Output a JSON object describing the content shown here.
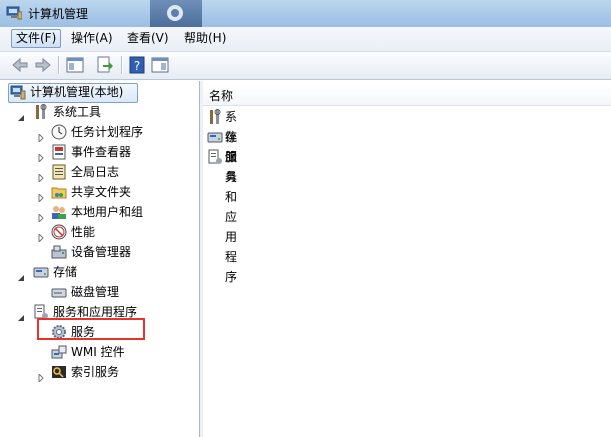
{
  "window": {
    "title": "计算机管理"
  },
  "menubar": {
    "items": [
      {
        "label": "文件(F)"
      },
      {
        "label": "操作(A)"
      },
      {
        "label": "查看(V)"
      },
      {
        "label": "帮助(H)"
      }
    ]
  },
  "tree": {
    "root": {
      "label": "计算机管理(本地)"
    },
    "system_tools": {
      "label": "系统工具"
    },
    "task_scheduler": {
      "label": "任务计划程序"
    },
    "event_viewer": {
      "label": "事件查看器"
    },
    "global_log": {
      "label": "全局日志"
    },
    "shared_folders": {
      "label": "共享文件夹"
    },
    "local_users": {
      "label": "本地用户和组"
    },
    "performance": {
      "label": "性能"
    },
    "device_manager": {
      "label": "设备管理器"
    },
    "storage": {
      "label": "存储"
    },
    "disk_management": {
      "label": "磁盘管理"
    },
    "services_apps": {
      "label": "服务和应用程序"
    },
    "services": {
      "label": "服务"
    },
    "wmi": {
      "label": "WMI 控件"
    },
    "indexing": {
      "label": "索引服务"
    }
  },
  "list": {
    "column_name": "名称",
    "items": [
      {
        "label": "系统工具"
      },
      {
        "label": "存储"
      },
      {
        "label": "服务和应用程序"
      }
    ]
  },
  "colors": {
    "highlight": "#e8332d",
    "titlebar": "#a9c8e8"
  }
}
